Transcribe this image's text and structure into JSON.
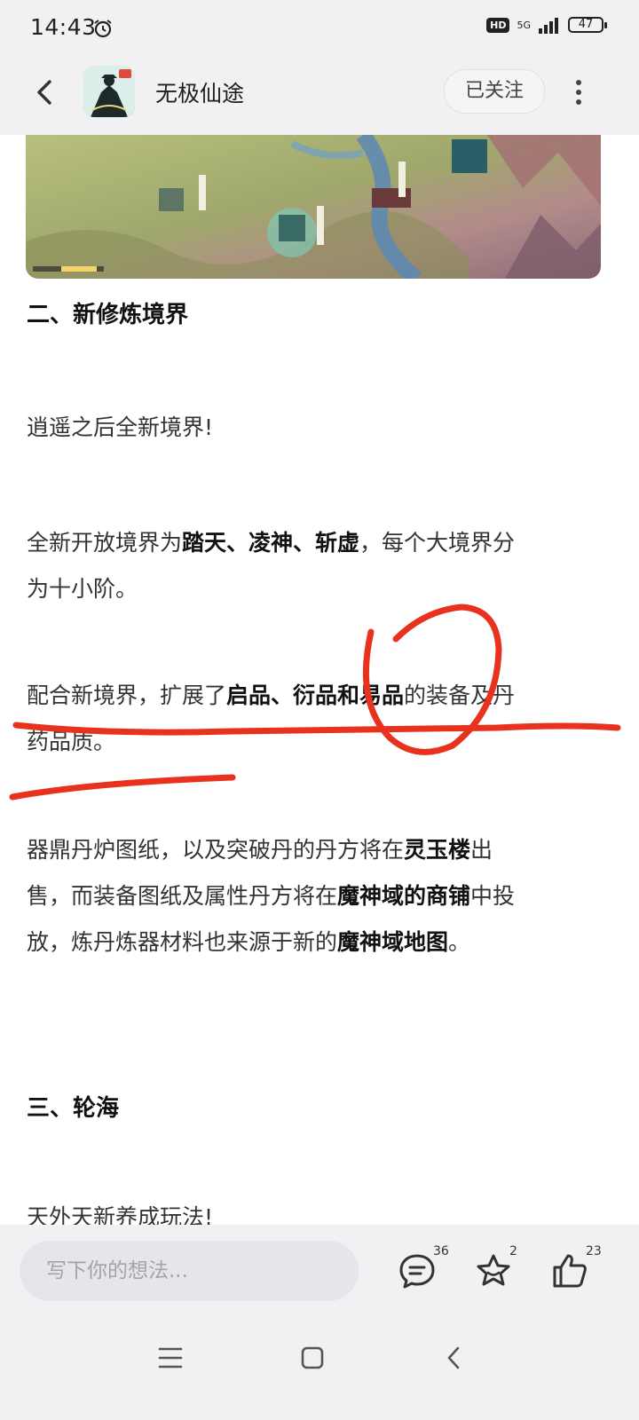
{
  "status_bar": {
    "time": "14:43",
    "hd": "HD",
    "network": "5G",
    "battery": "47"
  },
  "header": {
    "title": "无极仙途",
    "follow_label": "已关注"
  },
  "article": {
    "heading_2": "二、新修炼境界",
    "p1": "逍遥之后全新境界!",
    "p2": {
      "t1": "全新开放境界为",
      "b1": "踏天、凌神、斩虚",
      "t2": "，每个大境界分",
      "t3": "为十小阶。"
    },
    "p3": {
      "t1": "配合新境界，扩展了",
      "b1": "启品、衍品和易品",
      "t2": "的装备及丹",
      "t3": "药品质。"
    },
    "p4": {
      "t1": "器鼎丹炉图纸，以及突破丹的丹方将在",
      "b1": "灵玉楼",
      "t2": "出",
      "t3": "售，而装备图纸及属性丹方将在",
      "b2": "魔神域的商铺",
      "t4": "中投",
      "t5": "放，炼丹炼器材料也来源于新的",
      "b3": "魔神域地图",
      "t6": "。"
    },
    "heading_3": "三、轮海",
    "p5": "天外天新养成玩法!"
  },
  "bottom_bar": {
    "comment_placeholder": "写下你的想法...",
    "comment_count": "36",
    "favorite_count": "2",
    "like_count": "23"
  },
  "colors": {
    "annotation_red": "#e8321e",
    "background": "#f1f1f4"
  },
  "icons": [
    "alarm-icon",
    "back-arrow-icon",
    "more-icon",
    "comment-icon",
    "star-icon",
    "thumbs-up-icon",
    "menu-icon",
    "home-icon",
    "back-icon"
  ]
}
